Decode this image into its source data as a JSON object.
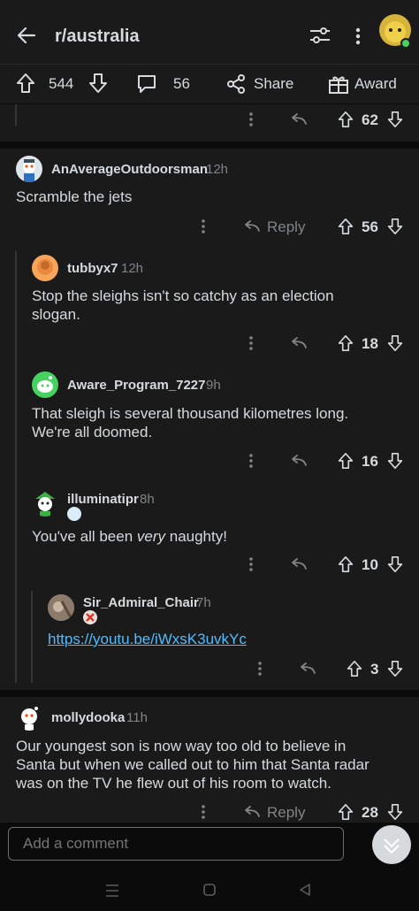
{
  "header": {
    "title": "r/australia"
  },
  "post_actions": {
    "upvotes": "544",
    "comments": "56",
    "share": "Share",
    "award": "Award"
  },
  "prev_comment": {
    "votes": "62"
  },
  "comments": [
    {
      "author": "AnAverageOutdoorsman",
      "time": "12h",
      "body": "Scramble the jets",
      "reply": "Reply",
      "votes": "56"
    },
    {
      "author": "tubbyx7",
      "time": "12h",
      "body_line1": "Stop the sleighs isn't so catchy as an election",
      "body_line2": "slogan.",
      "votes": "18"
    },
    {
      "author": "Aware_Program_7227",
      "time": "9h",
      "body_line1": "That sleigh is several thousand kilometres long.",
      "body_line2": "We're all doomed.",
      "votes": "16"
    },
    {
      "author": "illuminatipr",
      "time": "8h",
      "body_pre": "You've all been ",
      "body_em": "very",
      "body_post": " naughty!",
      "votes": "10"
    },
    {
      "author": "Sir_Admiral_Chair",
      "time": "7h",
      "link": "https://youtu.be/iWxsK3uvkYc",
      "votes": "3"
    },
    {
      "author": "mollydooka",
      "time": "11h",
      "body_line1": "Our youngest son is now way too old to believe in",
      "body_line2": "Santa but when we called out to him that Santa radar",
      "body_line3": "was on the TV he flew out of his room to watch.",
      "reply": "Reply",
      "votes": "28"
    }
  ],
  "composer": {
    "placeholder": "Add a comment"
  },
  "colors": {
    "background": "#0b0b0b",
    "card": "#1a1a1b",
    "text": "#d7dadc",
    "muted": "#818384",
    "link": "#4fbcff"
  }
}
